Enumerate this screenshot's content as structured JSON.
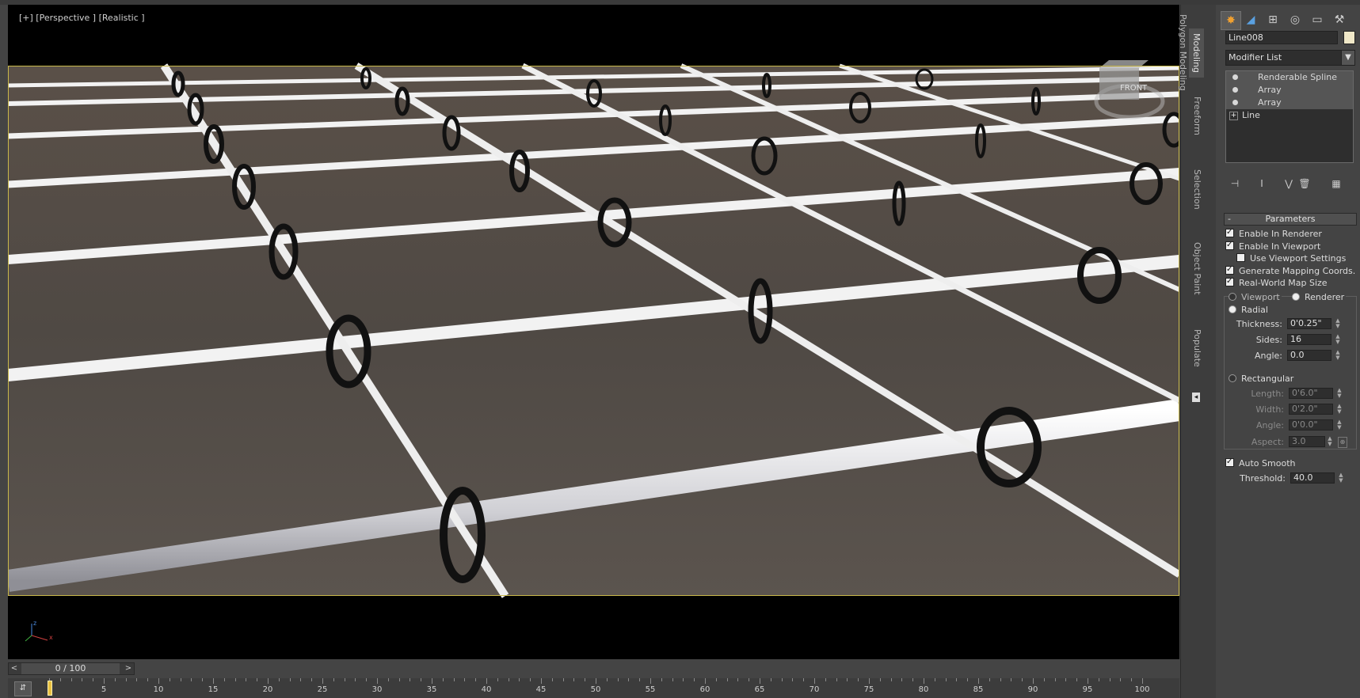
{
  "viewport": {
    "label": "[+] [Perspective ] [Realistic ]",
    "viewcube_label": "FRONT"
  },
  "ribbon": {
    "tabs": [
      "Modeling",
      "Polygon Modeling",
      "Freeform",
      "Selection",
      "Object Paint",
      "Populate"
    ]
  },
  "command_panel": {
    "tab_icons": [
      "create-icon",
      "modify-icon",
      "hierarchy-icon",
      "motion-icon",
      "display-icon",
      "utilities-icon"
    ],
    "object_name": "Line008",
    "object_color": "#f0e8c8",
    "modifier_list_label": "Modifier List",
    "stack": [
      {
        "label": "Renderable Spline",
        "icon": "bulb"
      },
      {
        "label": "Array",
        "icon": "bulb"
      },
      {
        "label": "Array",
        "icon": "bulb"
      },
      {
        "label": "Line",
        "icon": "plus"
      }
    ],
    "parameters": {
      "title": "Parameters",
      "enable_in_renderer": {
        "label": "Enable In Renderer",
        "checked": true
      },
      "enable_in_viewport": {
        "label": "Enable In Viewport",
        "checked": true
      },
      "use_viewport_settings": {
        "label": "Use Viewport Settings",
        "checked": false
      },
      "generate_mapping": {
        "label": "Generate Mapping Coords.",
        "checked": true
      },
      "real_world_map": {
        "label": "Real-World Map Size",
        "checked": true
      },
      "viewport_radio": {
        "label": "Viewport",
        "selected": false
      },
      "renderer_radio": {
        "label": "Renderer",
        "selected": true
      },
      "radial_radio": {
        "label": "Radial",
        "selected": true
      },
      "thickness": {
        "label": "Thickness:",
        "value": "0'0.25\""
      },
      "sides": {
        "label": "Sides:",
        "value": "16"
      },
      "angle": {
        "label": "Angle:",
        "value": "0.0"
      },
      "rectangular_radio": {
        "label": "Rectangular",
        "selected": false
      },
      "length": {
        "label": "Length:",
        "value": "0'6.0\""
      },
      "width": {
        "label": "Width:",
        "value": "0'2.0\""
      },
      "rect_angle": {
        "label": "Angle:",
        "value": "0'0.0\""
      },
      "aspect": {
        "label": "Aspect:",
        "value": "3.0"
      },
      "auto_smooth": {
        "label": "Auto Smooth",
        "checked": true
      },
      "threshold": {
        "label": "Threshold:",
        "value": "40.0"
      }
    }
  },
  "timeline": {
    "frame_display": "0 / 100",
    "prev": "<",
    "next": ">",
    "ticks": [
      "0",
      "5",
      "10",
      "15",
      "20",
      "25",
      "30",
      "35",
      "40",
      "45",
      "50",
      "55",
      "60",
      "65",
      "70",
      "75",
      "80",
      "85",
      "90",
      "95",
      "100"
    ],
    "current_frame": 0
  }
}
